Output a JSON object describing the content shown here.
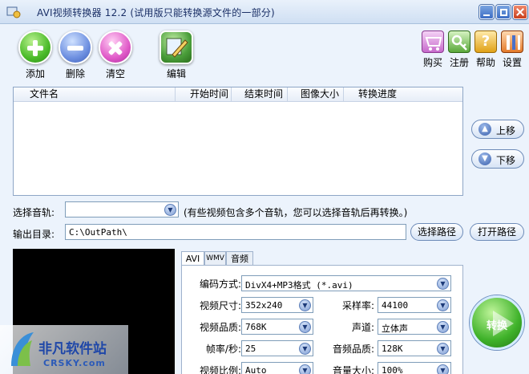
{
  "window": {
    "title": "AVI视频转换器 12.2 (试用版只能转换源文件的一部分)"
  },
  "toolbar": {
    "add": "添加",
    "remove": "删除",
    "clear": "清空",
    "edit": "编辑",
    "buy": "购买",
    "register": "注册",
    "help": "帮助",
    "settings": "设置"
  },
  "filelist": {
    "columns": [
      "文件名",
      "开始时间",
      "结束时间",
      "图像大小",
      "转换进度"
    ],
    "rows": []
  },
  "side": {
    "move_up": "上移",
    "move_down": "下移"
  },
  "audio_track": {
    "label": "选择音轨:",
    "value": "",
    "hint": "(有些视频包含多个音轨，您可以选择音轨后再转换。)"
  },
  "output": {
    "label": "输出目录:",
    "value": "C:\\OutPath\\",
    "browse": "选择路径",
    "open": "打开路径"
  },
  "tabs": [
    "AVI",
    "WMV",
    "音频"
  ],
  "settings": {
    "codec_label": "编码方式:",
    "codec_value": "DivX4+MP3格式 (*.avi)",
    "size_label": "视频尺寸:",
    "size_value": "352x240",
    "samplerate_label": "采样率:",
    "samplerate_value": "44100",
    "quality_label": "视频品质:",
    "quality_value": "768K",
    "channel_label": "声道:",
    "channel_value": "立体声",
    "fps_label": "帧率/秒:",
    "fps_value": "25",
    "audio_quality_label": "音频品质:",
    "audio_quality_value": "128K",
    "aspect_label": "视频比例:",
    "aspect_value": "Auto",
    "volume_label": "音量大小:",
    "volume_value": "100%"
  },
  "convert": "转换",
  "watermark": {
    "name": "非凡软件站",
    "site": "CRSKY.com"
  }
}
